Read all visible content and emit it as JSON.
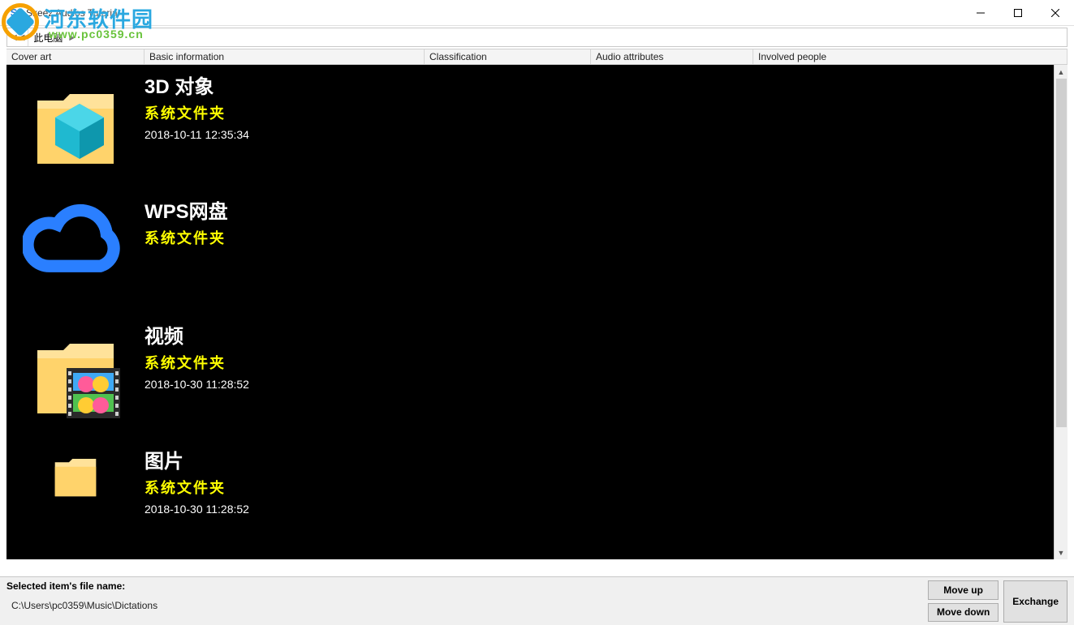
{
  "window": {
    "title": "Skeez Audios Tutorial"
  },
  "watermark": {
    "line1": "河东软件园",
    "line2": "www.pc0359.cn"
  },
  "breadcrumb": {
    "location": "此电脑"
  },
  "columns": [
    "Cover art",
    "Basic information",
    "Classification",
    "Audio attributes",
    "Involved people"
  ],
  "items": [
    {
      "icon": "folder-3d",
      "title": "3D 对象",
      "subtitle": "系统文件夹",
      "date": "2018-10-11 12:35:34"
    },
    {
      "icon": "cloud",
      "title": "WPS网盘",
      "subtitle": "系统文件夹",
      "date": ""
    },
    {
      "icon": "folder-video",
      "title": "视频",
      "subtitle": "系统文件夹",
      "date": "2018-10-30 11:28:52"
    },
    {
      "icon": "folder-plain",
      "title": "图片",
      "subtitle": "系统文件夹",
      "date": "2018-10-30 11:28:52"
    }
  ],
  "bottom": {
    "label": "Selected item's file name:",
    "value": "C:\\Users\\pc0359\\Music\\Dictations",
    "move_up": "Move up",
    "move_down": "Move down",
    "exchange": "Exchange"
  }
}
